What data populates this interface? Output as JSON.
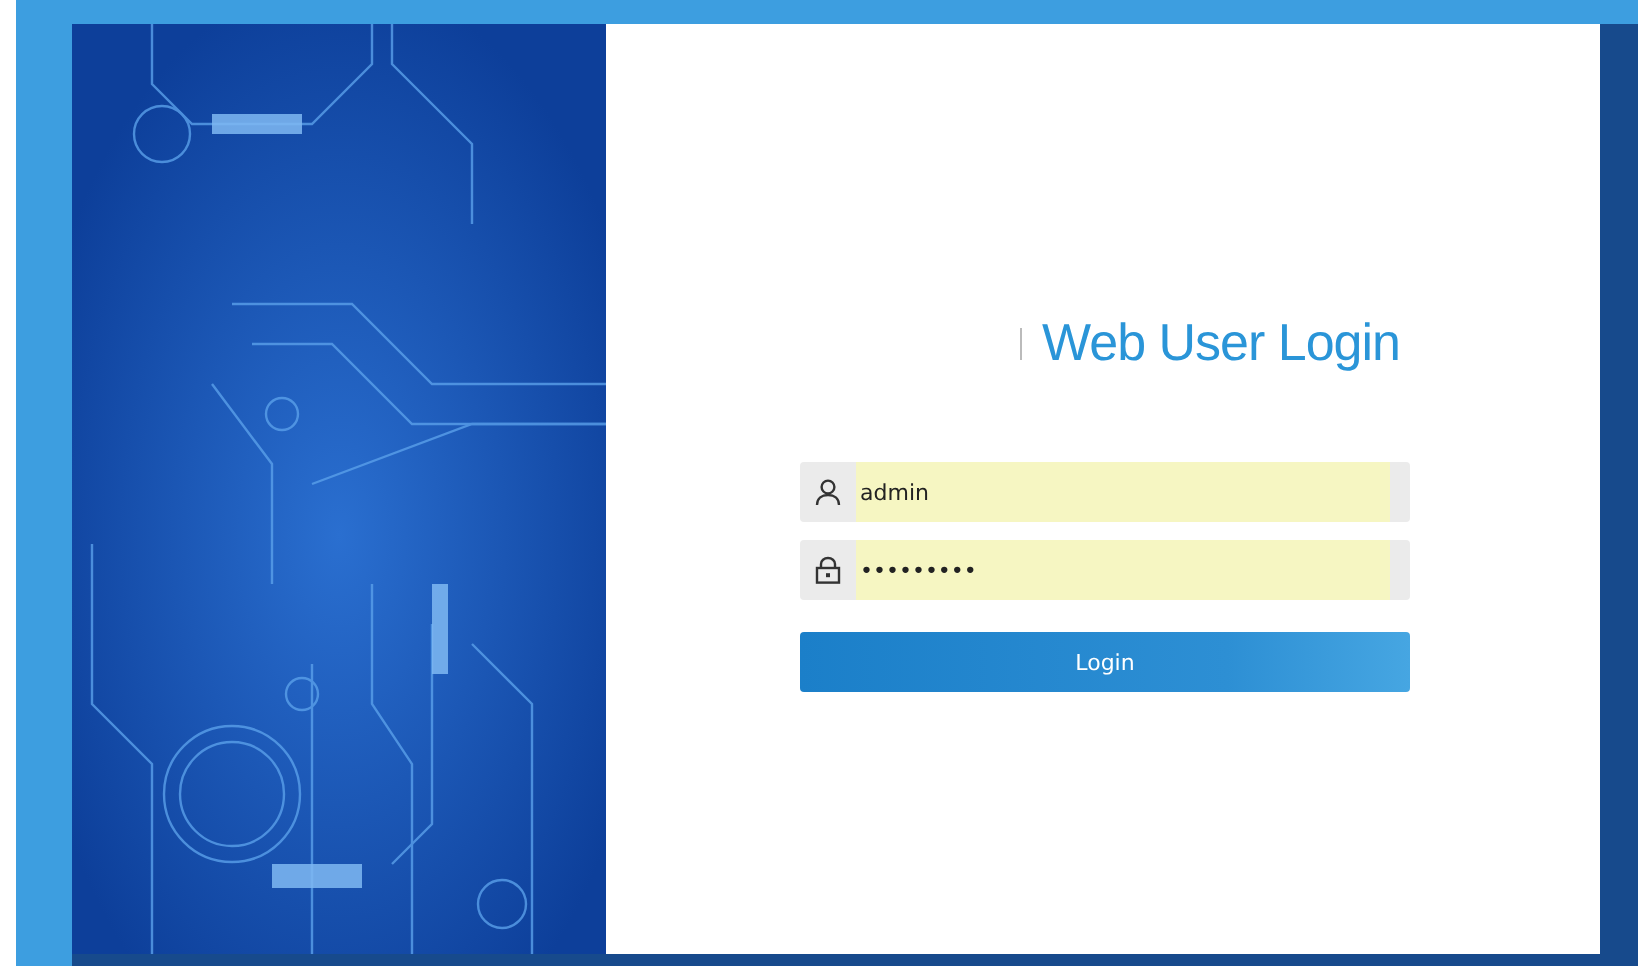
{
  "title": "Web User Login",
  "fields": [
    {
      "kind": "username",
      "value": "admin"
    },
    {
      "kind": "password",
      "value": "•••••••••"
    }
  ],
  "login_button": "Login"
}
